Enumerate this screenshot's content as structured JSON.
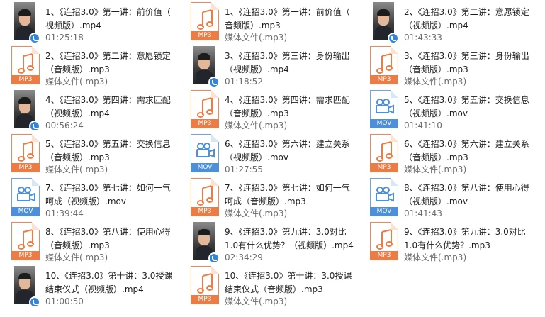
{
  "colors": {
    "mp3": "#ec7c45",
    "mov": "#4d8fd9",
    "text": "#1e1e1e",
    "meta": "#6d6d6d"
  },
  "files": [
    {
      "icon": "video-thumbnail-icon",
      "type": "video",
      "name": "1、《连招3.0》第一讲：前价值（\n视频版）.mp4",
      "meta": "01:25:18"
    },
    {
      "icon": "mp3-file-icon",
      "type": "mp3",
      "badge": "MP3",
      "name": "1、《连招3.0》第一讲：前价值（\n音频版）.mp3",
      "meta": "媒体文件(.mp3)"
    },
    {
      "icon": "video-thumbnail-icon",
      "type": "video",
      "name": "2、《连招3.0》第二讲：意愿锁定\n（视频版）.mp4",
      "meta": "01:43:33"
    },
    {
      "icon": "mp3-file-icon",
      "type": "mp3",
      "badge": "MP3",
      "name": "2、《连招3.0》第二讲：意愿锁定\n（音频版）.mp3",
      "meta": "媒体文件(.mp3)"
    },
    {
      "icon": "video-thumbnail-icon",
      "type": "video",
      "name": "3、《连招3.0》第三讲：身份输出\n（视频版）.mp4",
      "meta": "01:18:52"
    },
    {
      "icon": "mp3-file-icon",
      "type": "mp3",
      "badge": "MP3",
      "name": "3、《连招3.0》第三讲：身份输出\n（音频版）.mp3",
      "meta": "媒体文件(.mp3)"
    },
    {
      "icon": "video-thumbnail-icon",
      "type": "video",
      "name": "4、《连招3.0》第四讲：需求匹配\n（视频版）.mp4",
      "meta": "00:56:24"
    },
    {
      "icon": "mp3-file-icon",
      "type": "mp3",
      "badge": "MP3",
      "name": "4、《连招3.0》第四讲：需求匹配\n（音频版）.mp3",
      "meta": "媒体文件(.mp3)"
    },
    {
      "icon": "mov-file-icon",
      "type": "mov",
      "badge": "MOV",
      "name": "5、《连招3.0》第五讲：交换信息\n（视频版）.mov",
      "meta": "01:41:10"
    },
    {
      "icon": "mp3-file-icon",
      "type": "mp3",
      "badge": "MP3",
      "name": "5、《连招3.0》第五讲：交换信息\n（音频版）.mp3",
      "meta": "媒体文件(.mp3)"
    },
    {
      "icon": "mov-file-icon",
      "type": "mov",
      "badge": "MOV",
      "name": "6、《连招3.0》第六讲：建立关系\n（视频版）.mov",
      "meta": "01:27:55"
    },
    {
      "icon": "mp3-file-icon",
      "type": "mp3",
      "badge": "MP3",
      "name": "6、《连招3.0》第六讲：建立关系\n（音频版）.mp3",
      "meta": "媒体文件(.mp3)"
    },
    {
      "icon": "mov-file-icon",
      "type": "mov",
      "badge": "MOV",
      "name": "7、《连招3.0》第七讲：如何一气\n呵成（视频版）.mov",
      "meta": "01:39:44"
    },
    {
      "icon": "mp3-file-icon",
      "type": "mp3",
      "badge": "MP3",
      "name": "7、《连招3.0》第七讲：如何一气\n呵成（音频版）.mp3",
      "meta": "媒体文件(.mp3)"
    },
    {
      "icon": "mov-file-icon",
      "type": "mov",
      "badge": "MOV",
      "name": "8、《连招3.0》第八讲：使用心得\n（视频版）.mov",
      "meta": "01:41:43"
    },
    {
      "icon": "mp3-file-icon",
      "type": "mp3",
      "badge": "MP3",
      "name": "8、《连招3.0》第八讲：使用心得\n（音频版）.mp3",
      "meta": "媒体文件(.mp3)"
    },
    {
      "icon": "video-thumbnail-icon",
      "type": "video",
      "name": "9、《连招3.0》第九讲：3.0对比\n1.0有什么优势？（视频版）.mp4",
      "meta": "02:34:29"
    },
    {
      "icon": "mp3-file-icon",
      "type": "mp3",
      "badge": "MP3",
      "name": "9、《连招3.0》第九讲：3.0对比\n1.0有什么优势？.mp3",
      "meta": "媒体文件(.mp3)"
    },
    {
      "icon": "video-thumbnail-icon",
      "type": "video",
      "name": "10、《连招3.0》第十讲：3.0授课\n结束仪式（视频版）.mp4",
      "meta": "01:00:50"
    },
    {
      "icon": "mp3-file-icon",
      "type": "mp3",
      "badge": "MP3",
      "name": "10、《连招3.0》第十讲：3.0授课\n结束仪式（音频版）.mp3",
      "meta": "媒体文件(.mp3)"
    }
  ]
}
